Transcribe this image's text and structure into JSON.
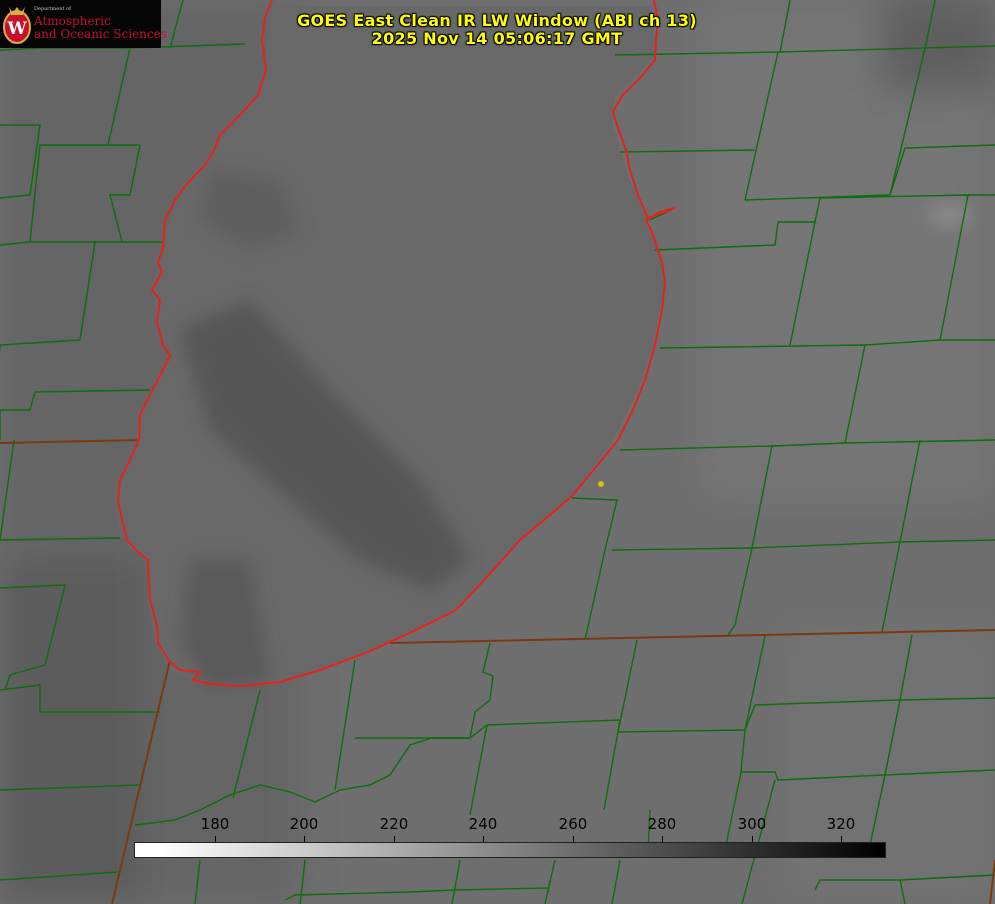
{
  "logo": {
    "dept": "Department of",
    "line1": "Atmospheric",
    "line2": "and Oceanic Sciences",
    "seal_letter": "W"
  },
  "title": {
    "line1": "GOES East Clean IR LW Window (ABI ch 13)",
    "line2": "2025 Nov 14 05:06:17 GMT"
  },
  "colorbar": {
    "ticks": [
      "180",
      "200",
      "220",
      "240",
      "260",
      "280",
      "300",
      "320"
    ]
  },
  "colors": {
    "county_lines": "#0c6e0c",
    "shoreline": "#e8201c",
    "state_lines": "#7a3a10",
    "title_text": "#ffff00",
    "marker": "#d8c010",
    "background": "#6c6c6c"
  },
  "layers": [
    "county-boundaries",
    "state-boundaries",
    "lake-shoreline",
    "city-marker"
  ]
}
